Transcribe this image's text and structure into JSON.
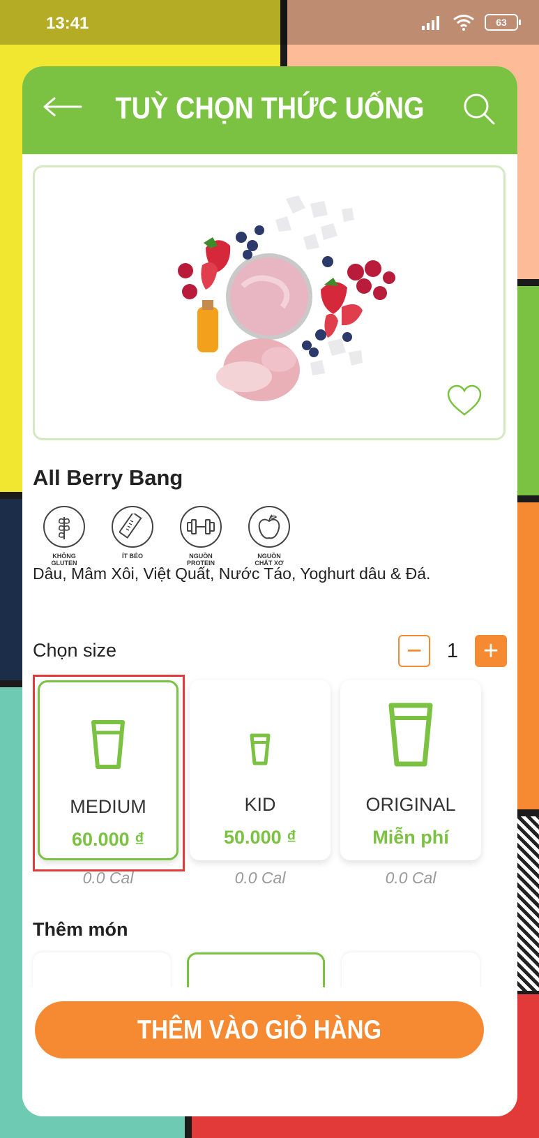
{
  "status_bar": {
    "time": "13:41",
    "battery": "63"
  },
  "header": {
    "title": "TUỲ CHỌN THỨC UỐNG"
  },
  "product": {
    "name": "All Berry Bang",
    "ingredients": "Dâu, Mâm Xôi, Việt Quất, Nước Táo, Yoghurt dâu & Đá.",
    "badges": [
      {
        "label": "KHÔNG\nGLUTEN",
        "icon": "wheat-icon"
      },
      {
        "label": "ÍT BÉO",
        "icon": "ruler-icon"
      },
      {
        "label": "NGUỒN\nPROTEIN",
        "icon": "dumbbell-icon"
      },
      {
        "label": "NGUỒN\nCHẤT XƠ",
        "icon": "apple-icon"
      }
    ]
  },
  "size_section": {
    "label": "Chọn size",
    "quantity": "1",
    "minus": "−",
    "plus": "+",
    "options": [
      {
        "name": "MEDIUM",
        "price": "60.000 ₫",
        "cal": "0.0 Cal",
        "selected": true
      },
      {
        "name": "KID",
        "price": "50.000 ₫",
        "cal": "0.0 Cal",
        "selected": false
      },
      {
        "name": "ORIGINAL",
        "price": "Miễn phí",
        "cal": "0.0 Cal",
        "selected": false
      }
    ]
  },
  "addon_section": {
    "label": "Thêm món"
  },
  "cta": {
    "label": "THÊM VÀO GIỎ HÀNG"
  },
  "colors": {
    "green": "#7bc142",
    "orange": "#f58a33",
    "highlight": "#e23a39"
  }
}
